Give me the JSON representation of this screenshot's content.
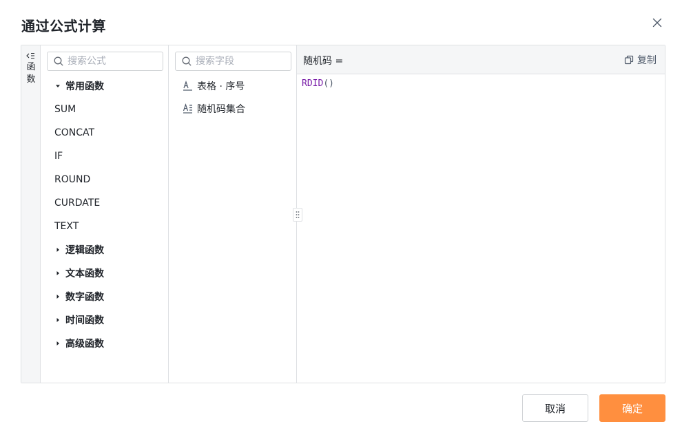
{
  "dialog": {
    "title": "通过公式计算",
    "close_icon": "close-icon"
  },
  "rail": {
    "icon": "collapse-menu-icon",
    "label": "函数"
  },
  "functions": {
    "search_placeholder": "搜索公式",
    "search_value": "",
    "expanded_group": "常用函数",
    "items": [
      "SUM",
      "CONCAT",
      "IF",
      "ROUND",
      "CURDATE",
      "TEXT"
    ],
    "groups": [
      "逻辑函数",
      "文本函数",
      "数字函数",
      "时间函数",
      "高级函数"
    ]
  },
  "fields": {
    "search_placeholder": "搜索字段",
    "search_value": "",
    "items": [
      {
        "label": "表格 · 序号",
        "icon": "text-field-icon"
      },
      {
        "label": "随机码集合",
        "icon": "text-list-field-icon"
      }
    ]
  },
  "editor": {
    "label": "随机码 =",
    "copy_label": "复制",
    "formula_fn": "RDID",
    "formula_args": "()"
  },
  "footer": {
    "cancel_label": "取消",
    "ok_label": "确定"
  },
  "colors": {
    "accent": "#ff8f3f",
    "function_name": "#7a1ea8",
    "border": "#dee0e3",
    "header_bg": "#f5f6f7"
  }
}
